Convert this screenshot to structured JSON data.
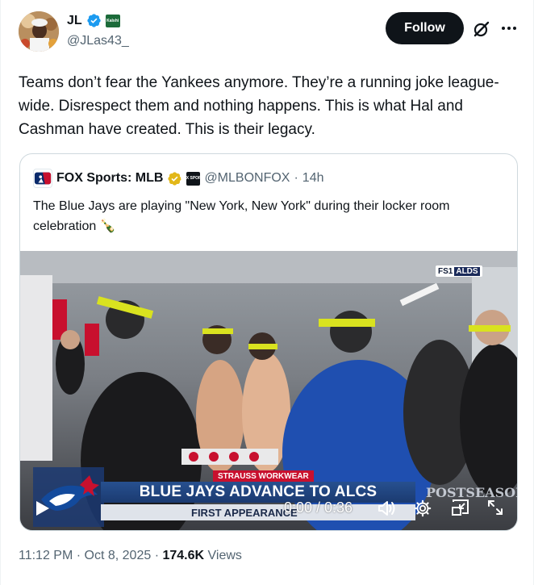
{
  "author": {
    "display_name": "JL",
    "handle": "@JLas43_",
    "affiliate_badge_text": "Kalshi",
    "avatar_icon": "avatar-photo"
  },
  "actions": {
    "follow_label": "Follow",
    "grok_icon": "grok-icon",
    "more_icon": "more-icon"
  },
  "tweet": {
    "text": "Teams don’t fear the Yankees anymore. They’re a running joke league-wide. Disrespect them and nothing happens. This is what Hal and Cashman have created. This is their legacy."
  },
  "quoted_tweet": {
    "display_name": "FOX Sports: MLB",
    "affiliate_badge_text": "FOX SPORTS",
    "handle": "@MLBONFOX",
    "separator": "·",
    "time": "14h",
    "text": "The Blue Jays are playing \"New York, New York\" during their locker room celebration 🍾",
    "video": {
      "network_badge": "FS1",
      "series_badge": "ALDS",
      "sponsor": "STRAUSS WORKWEAR",
      "headline": "BLUE JAYS ADVANCE TO ALCS",
      "subline": "FIRST APPEARANCE",
      "brand_mark": "POSTSEASON",
      "time_display": "0:00 / 0:36"
    }
  },
  "meta": {
    "time": "11:12 PM",
    "separator": "·",
    "date": "Oct 8, 2025",
    "views_count": "174.6K",
    "views_label": "Views"
  },
  "colors": {
    "text": "#0f1419",
    "secondary": "#536471",
    "verified_blue": "#1d9bf0",
    "verified_gold": "#e2b719",
    "border": "#cfd9de"
  }
}
